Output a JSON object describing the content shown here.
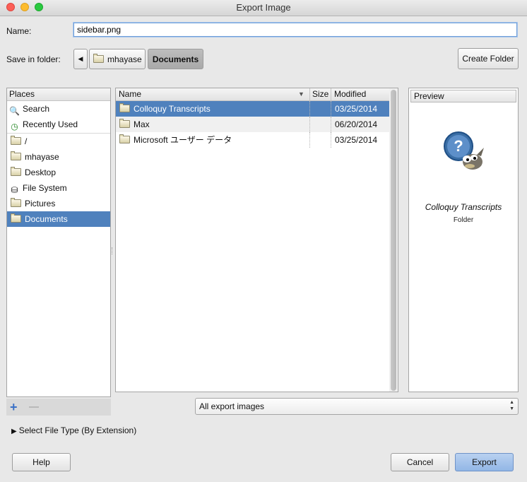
{
  "window": {
    "title": "Export Image"
  },
  "name_field": {
    "label": "Name:",
    "value": "sidebar.png"
  },
  "save_in": {
    "label": "Save in folder:",
    "path": [
      "mhayase",
      "Documents"
    ],
    "create_folder_label": "Create Folder"
  },
  "places": {
    "header": "Places",
    "items": [
      {
        "label": "Search",
        "icon": "search-icon"
      },
      {
        "label": "Recently Used",
        "icon": "recent-icon"
      },
      {
        "label": "/",
        "icon": "folder-icon"
      },
      {
        "label": "mhayase",
        "icon": "folder-icon"
      },
      {
        "label": "Desktop",
        "icon": "folder-icon"
      },
      {
        "label": "File System",
        "icon": "drive-icon"
      },
      {
        "label": "Pictures",
        "icon": "folder-icon"
      },
      {
        "label": "Documents",
        "icon": "folder-icon",
        "selected": true
      }
    ],
    "add_glyph": "+"
  },
  "files": {
    "columns": {
      "name": "Name",
      "size": "Size",
      "modified": "Modified"
    },
    "rows": [
      {
        "name": "Colloquy Transcripts",
        "size": "",
        "modified": "03/25/2014",
        "selected": true
      },
      {
        "name": "Max",
        "size": "",
        "modified": "06/20/2014"
      },
      {
        "name": "Microsoft ユーザー データ",
        "size": "",
        "modified": "03/25/2014"
      }
    ]
  },
  "preview": {
    "header": "Preview",
    "title": "Colloquy Transcripts",
    "subtitle": "Folder"
  },
  "filter": {
    "selected": "All export images"
  },
  "file_type_expander": {
    "label": "Select File Type (By Extension)"
  },
  "buttons": {
    "help": "Help",
    "cancel": "Cancel",
    "export": "Export"
  },
  "colors": {
    "selection": "#4f81bd",
    "accent_button": "#a6c4eb"
  }
}
